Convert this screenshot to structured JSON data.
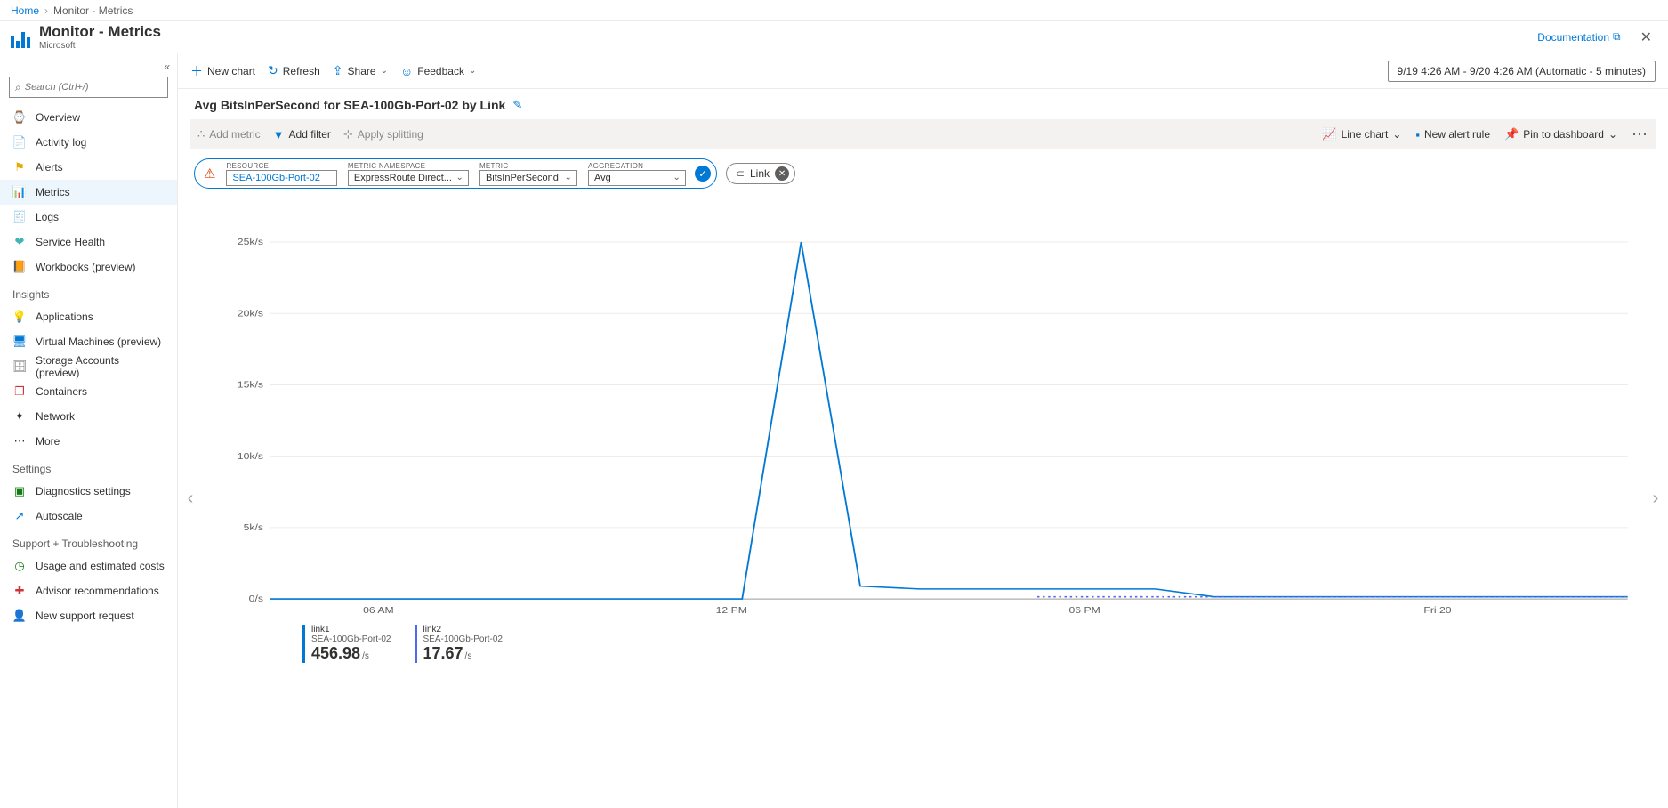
{
  "breadcrumb": {
    "home": "Home",
    "current": "Monitor - Metrics"
  },
  "header": {
    "title": "Monitor - Metrics",
    "subtitle": "Microsoft",
    "docs": "Documentation"
  },
  "sidebar": {
    "search_placeholder": "Search (Ctrl+/)",
    "items": [
      {
        "label": "Overview",
        "icon": "⌚",
        "color": "#6b6b6b"
      },
      {
        "label": "Activity log",
        "icon": "📄",
        "color": "#0078d4"
      },
      {
        "label": "Alerts",
        "icon": "⚑",
        "color": "#e8a900"
      },
      {
        "label": "Metrics",
        "icon": "📊",
        "color": "#0078d4",
        "active": true
      },
      {
        "label": "Logs",
        "icon": "🧾",
        "color": "#8661c5"
      },
      {
        "label": "Service Health",
        "icon": "❤",
        "color": "#40b5b5"
      },
      {
        "label": "Workbooks (preview)",
        "icon": "📙",
        "color": "#ca5010"
      }
    ],
    "insights_heading": "Insights",
    "insights": [
      {
        "label": "Applications",
        "icon": "💡",
        "color": "#8661c5"
      },
      {
        "label": "Virtual Machines (preview)",
        "icon": "🖥",
        "color": "#0078d4"
      },
      {
        "label": "Storage Accounts (preview)",
        "icon": "🗄",
        "color": "#6b6b6b"
      },
      {
        "label": "Containers",
        "icon": "❐",
        "color": "#d13438"
      },
      {
        "label": "Network",
        "icon": "✦",
        "color": "#323130"
      },
      {
        "label": "More",
        "icon": "⋯",
        "color": "#323130"
      }
    ],
    "settings_heading": "Settings",
    "settings": [
      {
        "label": "Diagnostics settings",
        "icon": "▣",
        "color": "#107c10"
      },
      {
        "label": "Autoscale",
        "icon": "↗",
        "color": "#0078d4"
      }
    ],
    "support_heading": "Support + Troubleshooting",
    "support": [
      {
        "label": "Usage and estimated costs",
        "icon": "◷",
        "color": "#107c10"
      },
      {
        "label": "Advisor recommendations",
        "icon": "✚",
        "color": "#d13438"
      },
      {
        "label": "New support request",
        "icon": "👤",
        "color": "#40b5b5"
      }
    ]
  },
  "cmdbar": {
    "new_chart": "New chart",
    "refresh": "Refresh",
    "share": "Share",
    "feedback": "Feedback",
    "timerange": "9/19 4:26 AM - 9/20 4:26 AM (Automatic - 5 minutes)"
  },
  "chart": {
    "title": "Avg BitsInPerSecond for SEA-100Gb-Port-02 by Link",
    "add_metric": "Add metric",
    "add_filter": "Add filter",
    "apply_splitting": "Apply splitting",
    "chart_type": "Line chart",
    "new_alert": "New alert rule",
    "pin": "Pin to dashboard"
  },
  "picker": {
    "lbl_resource": "RESOURCE",
    "lbl_ns": "METRIC NAMESPACE",
    "lbl_metric": "METRIC",
    "lbl_agg": "AGGREGATION",
    "resource": "SEA-100Gb-Port-02",
    "ns": "ExpressRoute Direct...",
    "metric": "BitsInPerSecond",
    "agg": "Avg"
  },
  "link_chip": "Link",
  "legend": [
    {
      "name": "link1",
      "sub": "SEA-100Gb-Port-02",
      "value": "456.98",
      "unit": "/s"
    },
    {
      "name": "link2",
      "sub": "SEA-100Gb-Port-02",
      "value": "17.67",
      "unit": "/s"
    }
  ],
  "chart_data": {
    "type": "line",
    "xlabel": "",
    "ylabel": "",
    "ylim": [
      0,
      25000
    ],
    "y_ticks": [
      0,
      5000,
      10000,
      15000,
      20000,
      25000
    ],
    "y_tick_labels": [
      "0/s",
      "5k/s",
      "10k/s",
      "15k/s",
      "20k/s",
      "25k/s"
    ],
    "x_tick_labels": [
      "06 AM",
      "12 PM",
      "06 PM",
      "Fri 20"
    ],
    "series": [
      {
        "name": "link1",
        "style": "solid",
        "color": "#0078d4",
        "values": [
          0,
          0,
          0,
          0,
          0,
          0,
          0,
          0,
          0,
          25000,
          900,
          700,
          700,
          700,
          700,
          700,
          150,
          150,
          150,
          150,
          150,
          150,
          150,
          150
        ]
      },
      {
        "name": "link2",
        "style": "dashed",
        "color": "#4f6bed",
        "values": [
          null,
          null,
          null,
          null,
          null,
          null,
          null,
          null,
          null,
          null,
          null,
          null,
          null,
          150,
          150,
          150,
          150,
          150,
          150,
          150,
          150,
          150,
          150,
          150
        ]
      }
    ]
  }
}
